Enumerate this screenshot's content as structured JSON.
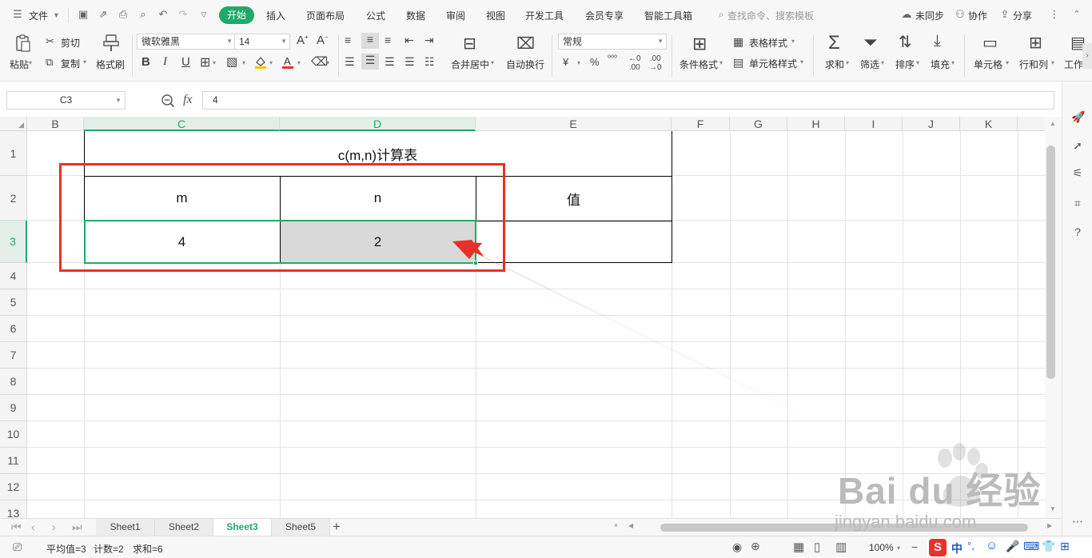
{
  "menubar": {
    "file": "文件",
    "tabs": [
      "开始",
      "插入",
      "页面布局",
      "公式",
      "数据",
      "审阅",
      "视图",
      "开发工具",
      "会员专享",
      "智能工具箱"
    ],
    "search_placeholder": "查找命令、搜索模板",
    "sync": "未同步",
    "collab": "协作",
    "share": "分享"
  },
  "ribbon": {
    "paste": "粘贴",
    "cut": "剪切",
    "copy": "复制",
    "format_painter": "格式刷",
    "font_name": "微软雅黑",
    "font_size": "14",
    "merge_center": "合并居中",
    "wrap_text": "自动换行",
    "number_format": "常规",
    "cond_format": "条件格式",
    "table_style": "表格样式",
    "cell_style": "单元格样式",
    "sum": "求和",
    "filter": "筛选",
    "sort": "排序",
    "fill": "填充",
    "cell": "单元格",
    "row_col": "行和列",
    "worksheet": "工作"
  },
  "formula_bar": {
    "name_box": "C3",
    "fx_label": "fx",
    "formula": "4"
  },
  "columns": [
    "B",
    "C",
    "D",
    "E",
    "F",
    "G",
    "H",
    "I",
    "J",
    "K"
  ],
  "rows": [
    "1",
    "2",
    "3",
    "4",
    "5",
    "6",
    "7",
    "8",
    "9",
    "10",
    "11",
    "12",
    "13"
  ],
  "table": {
    "title": "c(m,n)计算表",
    "headers": [
      "m",
      "n",
      "值"
    ],
    "values": [
      "4",
      "2",
      ""
    ]
  },
  "sheets": [
    "Sheet1",
    "Sheet2",
    "Sheet3",
    "Sheet5"
  ],
  "active_sheet": "Sheet3",
  "status": {
    "average": "平均值=3",
    "count": "计数=2",
    "sum": "求和=6",
    "zoom": "100%",
    "ime": "中"
  },
  "watermark": {
    "brand": "Bai du 经验",
    "url": "jingyan.baidu.com"
  },
  "colors": {
    "accent": "#1faa6a",
    "annotation": "#e8312a",
    "selected_fill": "#d9d9d9"
  }
}
